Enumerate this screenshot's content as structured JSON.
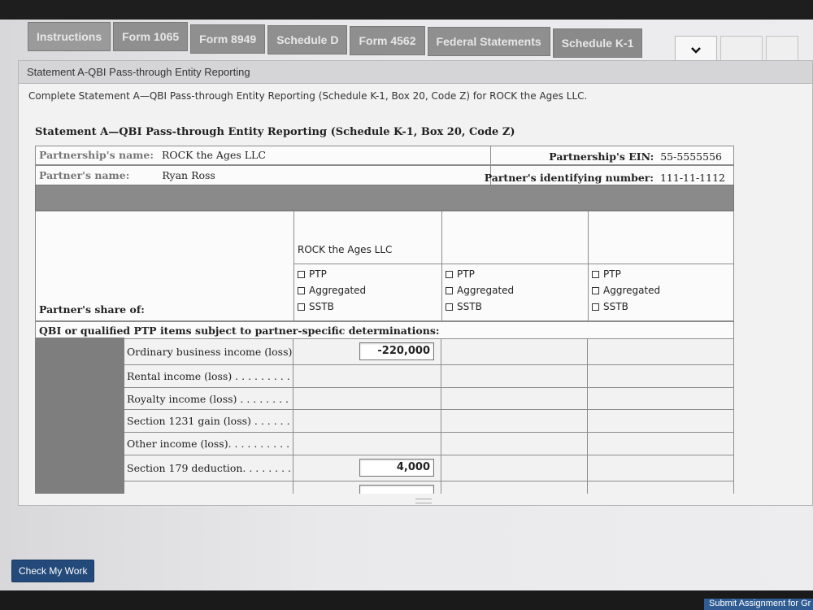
{
  "tabs": [
    "Instructions",
    "Form 1065",
    "Form 8949",
    "Schedule D",
    "Form 4562",
    "Federal Statements",
    "Schedule K-1"
  ],
  "panel": {
    "header": "Statement A-QBI Pass-through Entity Reporting",
    "instructions": "Complete Statement A—QBI Pass-through Entity Reporting (Schedule K-1, Box 20, Code Z) for ROCK the Ages LLC."
  },
  "statement": {
    "title": "Statement A—QBI Pass-through Entity Reporting (Schedule K-1, Box 20, Code Z)",
    "partnership_name_label": "Partnership's name:",
    "partnership_name": "ROCK the Ages LLC",
    "partnership_ein_label": "Partnership's EIN:",
    "partnership_ein": "55-5555556",
    "partner_name_label": "Partner's name:",
    "partner_name": "Ryan Ross",
    "partner_id_label": "Partner's identifying number:",
    "partner_id": "111-11-1112",
    "share_label": "Partner's share of:",
    "entity_col1": "ROCK the Ages LLC",
    "options": [
      "PTP",
      "Aggregated",
      "SSTB"
    ],
    "section_label": "QBI or qualified PTP items subject to partner-specific determinations:",
    "items": [
      {
        "label": "Ordinary business income (loss)",
        "value": "-220,000"
      },
      {
        "label": "Rental income (loss) . . . . . . . . .",
        "value": ""
      },
      {
        "label": "Royalty income (loss) . . . . . . . .",
        "value": ""
      },
      {
        "label": "Section 1231 gain (loss) . . . . . .",
        "value": ""
      },
      {
        "label": "Other income (loss). . . . . . . . . .",
        "value": ""
      },
      {
        "label": "Section 179 deduction. . . . . . . .",
        "value": "4,000"
      },
      {
        "label": "",
        "value": ""
      }
    ]
  },
  "buttons": {
    "check_my_work": "Check My Work",
    "submit": "Submit Assignment for Gr"
  },
  "icons": {
    "dropdown": "chevron-down-icon"
  }
}
